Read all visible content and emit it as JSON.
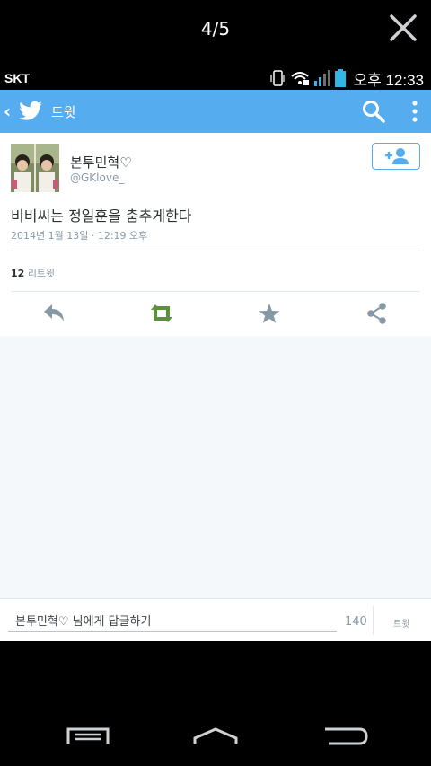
{
  "viewer": {
    "page_counter": "4/5"
  },
  "status_bar": {
    "carrier": "SKT",
    "time": "오후 12:33"
  },
  "app_bar": {
    "title": "트윗"
  },
  "tweet": {
    "display_name": "본투민혁♡",
    "handle": "@GKlove_",
    "text": "비비씨는 정일훈을 춤추게한다",
    "timestamp": "2014년 1월 13일 · 12:19 오후",
    "retweet_count": "12",
    "retweet_label": "리트윗"
  },
  "reply_bar": {
    "placeholder": "본투민혁♡ 님에게 답글하기",
    "char_count": "140",
    "tweet_label": "트윗"
  },
  "colors": {
    "brand": "#55acee",
    "retweet_active": "#5c913b",
    "action_gray": "#8899a6"
  },
  "icons": [
    "close-icon",
    "phone-vibrate-icon",
    "wifi-lock-icon",
    "signal-icon",
    "battery-icon",
    "twitter-bird-icon",
    "search-icon",
    "overflow-menu-icon",
    "follow-icon",
    "reply-icon",
    "retweet-icon",
    "favorite-icon",
    "share-icon",
    "recent-apps-icon",
    "home-icon",
    "back-icon"
  ]
}
